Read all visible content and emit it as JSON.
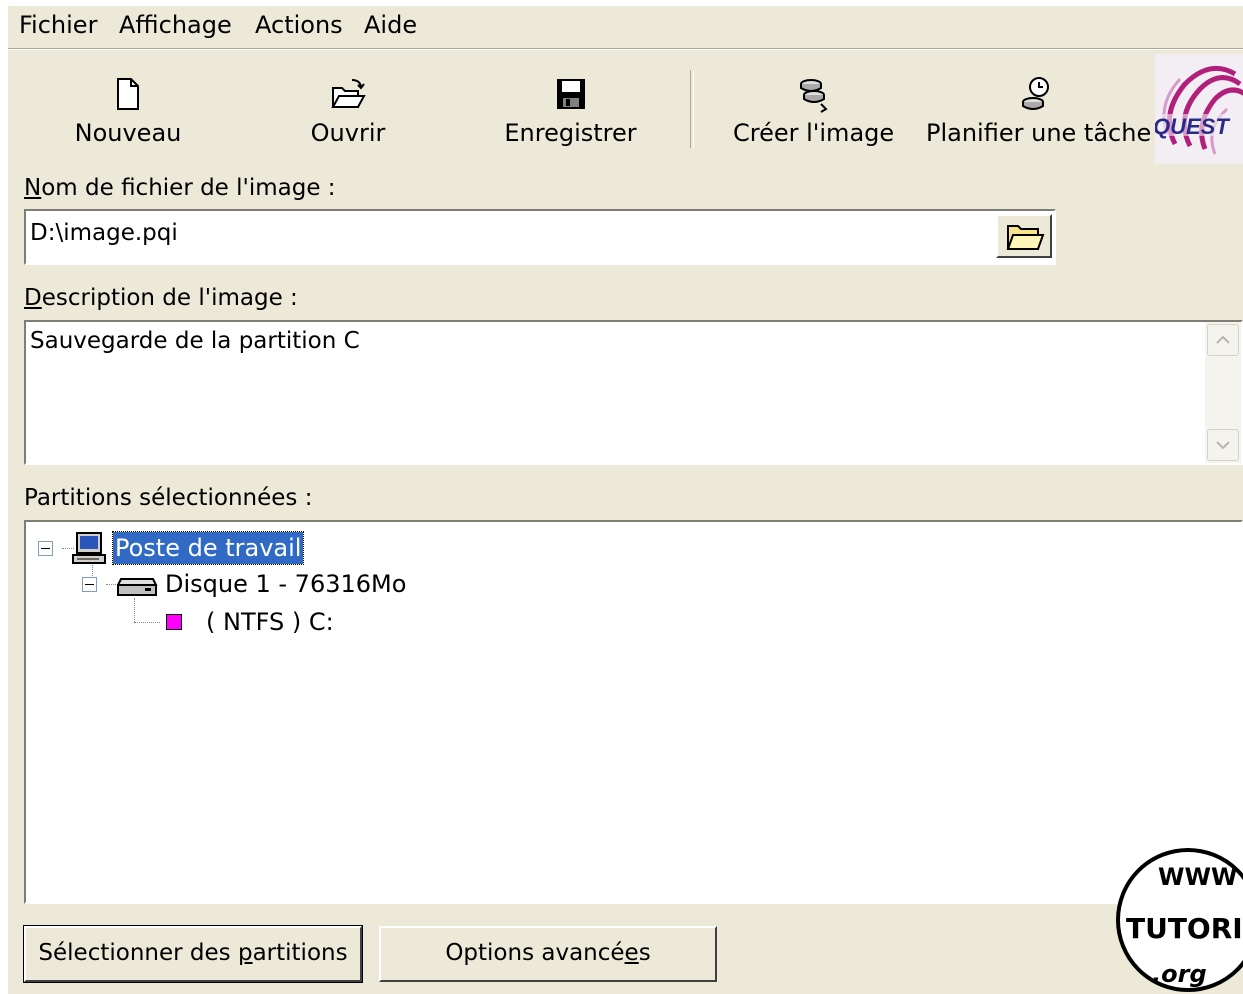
{
  "menu": {
    "items": [
      "Fichier",
      "Affichage",
      "Actions",
      "Aide"
    ]
  },
  "toolbar": {
    "new_label": "Nouveau",
    "open_label": "Ouvrir",
    "save_label": "Enregistrer",
    "create_label": "Créer l'image",
    "schedule_label": "Planifier une tâche",
    "logo_text": "QUEST"
  },
  "image_file": {
    "label_first": "N",
    "label_rest": "om de fichier de l'image :",
    "value": "D:\\image.pqi"
  },
  "description": {
    "label_first": "D",
    "label_rest": "escription de l'image :",
    "value": "Sauvegarde de la partition C"
  },
  "partitions": {
    "label": "Partitions sélectionnées :",
    "tree": {
      "root": "Poste de travail",
      "disk": "Disque 1 - 76316Mo",
      "partition": "( NTFS ) C:",
      "partition_color": "#ff00ff"
    }
  },
  "buttons": {
    "select_pre": "Sélectionner des ",
    "select_u": "p",
    "select_post": "artitions",
    "options_pre": "Options avancé",
    "options_u": "e",
    "options_post": "s"
  },
  "watermark": {
    "top": "WWW",
    "middle": "TUTORIEL",
    "bottom": ".org"
  },
  "colors": {
    "window_bg": "#ece9d8",
    "selection": "#316ac5",
    "partition_marker": "#ff00ff"
  }
}
